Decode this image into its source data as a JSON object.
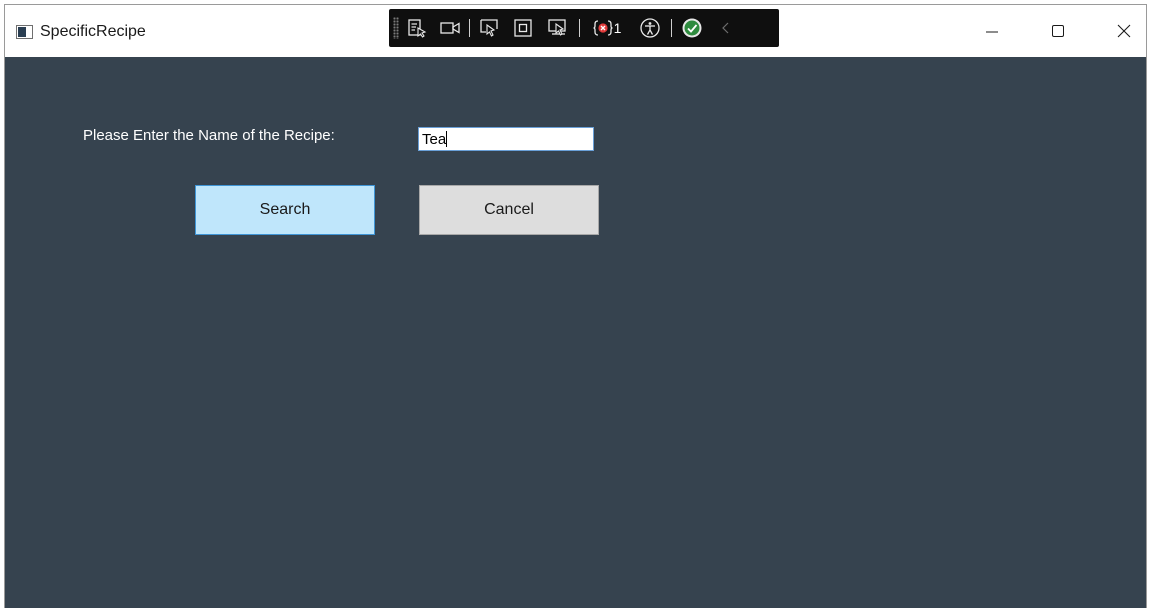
{
  "window": {
    "title": "SpecificRecipe"
  },
  "devtools": {
    "error_count": "1",
    "icons": [
      "select-element-icon",
      "record-icon",
      "pointer-select-icon",
      "frame-icon",
      "adorner-icon",
      "binding-errors-icon",
      "accessibility-icon",
      "checkmark-icon",
      "collapse-chevron-icon"
    ]
  },
  "form": {
    "prompt": "Please Enter the Name of the Recipe:",
    "recipe_name_value": "Tea",
    "search_label": "Search",
    "cancel_label": "Cancel"
  },
  "colors": {
    "client_background": "#36434f",
    "search_button": "#bfe6fb",
    "search_border": "#3f95d6",
    "cancel_button": "#dddddd",
    "input_border": "#6aa0d8"
  }
}
